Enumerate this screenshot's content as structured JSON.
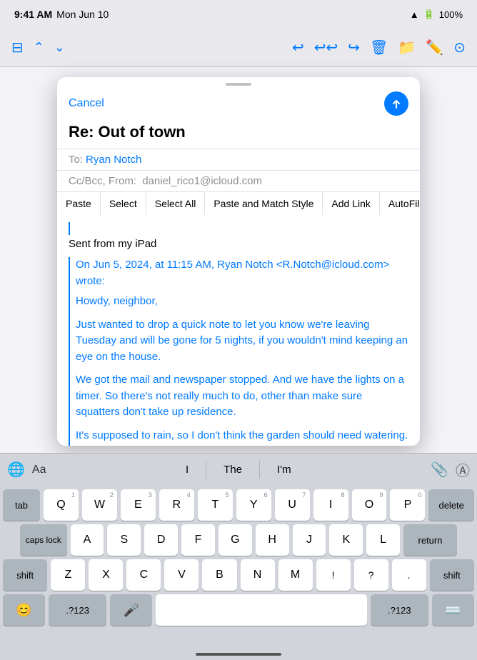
{
  "statusBar": {
    "time": "9:41 AM",
    "date": "Mon Jun 10",
    "wifi": "●●●",
    "battery": "100%"
  },
  "toolbar": {
    "icons": [
      "sidebar",
      "chevron-up",
      "chevron-down",
      "reply",
      "reply-all",
      "forward",
      "trash",
      "folder",
      "compose",
      "more"
    ]
  },
  "compose": {
    "dragHandle": true,
    "cancelLabel": "Cancel",
    "subject": "Re: Out of town",
    "to": {
      "label": "To:",
      "name": "Ryan Notch"
    },
    "ccBcc": {
      "label": "Cc/Bcc, From:",
      "value": "daniel_rico1@icloud.com"
    },
    "contextMenu": {
      "items": [
        "Paste",
        "Select",
        "Select All",
        "Paste and Match Style",
        "Add Link",
        "AutoFill"
      ],
      "arrowLabel": "›"
    },
    "body": {
      "sentFrom": "Sent from my iPad",
      "quotedHeader": "On Jun 5, 2024, at 11:15 AM, Ryan Notch <R.Notch@icloud.com> wrote:",
      "paragraphs": [
        "Howdy, neighbor,",
        "Just wanted to drop a quick note to let you know we're leaving Tuesday and will be gone for 5 nights, if you wouldn't mind keeping an eye on the house.",
        "We got the mail and newspaper stopped. And we have the lights on a timer. So there's not really much to do, other than make sure squatters don't take up residence.",
        "It's supposed to rain, so I don't think the garden should need watering. But on the incredibly remote chance the weatherman is actually wrong, perhaps you could give it a quick sprinkling. Thanks. We'll see you when we get back!"
      ]
    }
  },
  "quicktype": {
    "fontLabel": "Aa",
    "suggestions": [
      "I",
      "The",
      "I'm"
    ]
  },
  "keyboard": {
    "rows": [
      [
        "Q",
        "W",
        "E",
        "R",
        "T",
        "Y",
        "U",
        "I",
        "O",
        "P"
      ],
      [
        "A",
        "S",
        "D",
        "F",
        "G",
        "H",
        "J",
        "K",
        "L"
      ],
      [
        "Z",
        "X",
        "C",
        "V",
        "B",
        "N",
        "M"
      ]
    ],
    "nums": {
      "Q": "1",
      "W": "2",
      "E": "3",
      "R": "4",
      "T": "5",
      "Y": "6",
      "U": "7",
      "I": "8",
      "O": "9",
      "P": "0",
      "A": "",
      "S": "",
      "D": "",
      "F": "",
      "G": "",
      "H": "",
      "J": "",
      "K": "",
      "L": "",
      "Z": "",
      "X": "",
      "C": "",
      "V": "",
      "B": "",
      "N": "",
      "M": ""
    },
    "specialLeft": "tab",
    "capsLock": "caps lock",
    "shiftLeft": "shift",
    "delete": "delete",
    "return": "return",
    "shiftRight": "shift",
    "emoji": "😊",
    "num123": ".?123",
    "space": "",
    "num123Right": ".?123"
  }
}
